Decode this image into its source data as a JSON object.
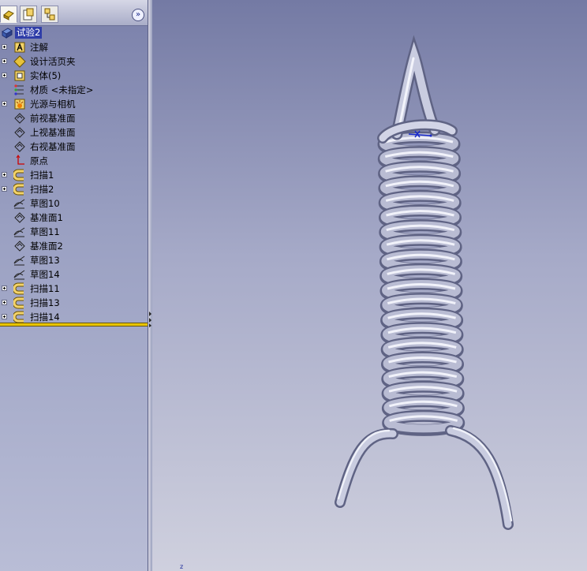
{
  "feature_manager": {
    "root": {
      "label": "试验2",
      "icon": "part-icon"
    },
    "items": [
      {
        "label": "注解",
        "icon": "annotations-icon",
        "expandable": true
      },
      {
        "label": "设计活页夹",
        "icon": "design-binder-icon",
        "expandable": true
      },
      {
        "label": "实体(5)",
        "icon": "solid-bodies-icon",
        "expandable": true
      },
      {
        "label": "材质 <未指定>",
        "icon": "material-icon",
        "expandable": false
      },
      {
        "label": "光源与相机",
        "icon": "lights-cameras-icon",
        "expandable": true
      },
      {
        "label": "前视基准面",
        "icon": "plane-icon",
        "expandable": false
      },
      {
        "label": "上视基准面",
        "icon": "plane-icon",
        "expandable": false
      },
      {
        "label": "右视基准面",
        "icon": "plane-icon",
        "expandable": false
      },
      {
        "label": "原点",
        "icon": "origin-icon",
        "expandable": false
      },
      {
        "label": "扫描1",
        "icon": "sweep-icon",
        "expandable": true
      },
      {
        "label": "扫描2",
        "icon": "sweep-icon",
        "expandable": true
      },
      {
        "label": "草图10",
        "icon": "sketch-icon",
        "expandable": false
      },
      {
        "label": "基准面1",
        "icon": "plane-icon",
        "expandable": false
      },
      {
        "label": "草图11",
        "icon": "sketch-icon",
        "expandable": false
      },
      {
        "label": "基准面2",
        "icon": "plane-icon",
        "expandable": false
      },
      {
        "label": "草图13",
        "icon": "sketch-icon",
        "expandable": false
      },
      {
        "label": "草图14",
        "icon": "sketch-icon",
        "expandable": false
      },
      {
        "label": "扫描11",
        "icon": "sweep-icon",
        "expandable": true
      },
      {
        "label": "扫描13",
        "icon": "sweep-icon",
        "expandable": true
      },
      {
        "label": "扫描14",
        "icon": "sweep-icon",
        "expandable": true
      }
    ],
    "tabs": [
      "feature-manager-tab-icon",
      "property-manager-tab-icon",
      "configuration-manager-tab-icon"
    ],
    "expand_button_icon": "double-chevron-right-icon"
  },
  "viewport": {
    "model": "spring-with-hook-and-legs",
    "triad_label": "z",
    "colors": {
      "spring_light": "#eef0fa",
      "spring_mid": "#b4b8cf",
      "spring_dark": "#6c7090",
      "selection": "#1a2ccc"
    }
  }
}
